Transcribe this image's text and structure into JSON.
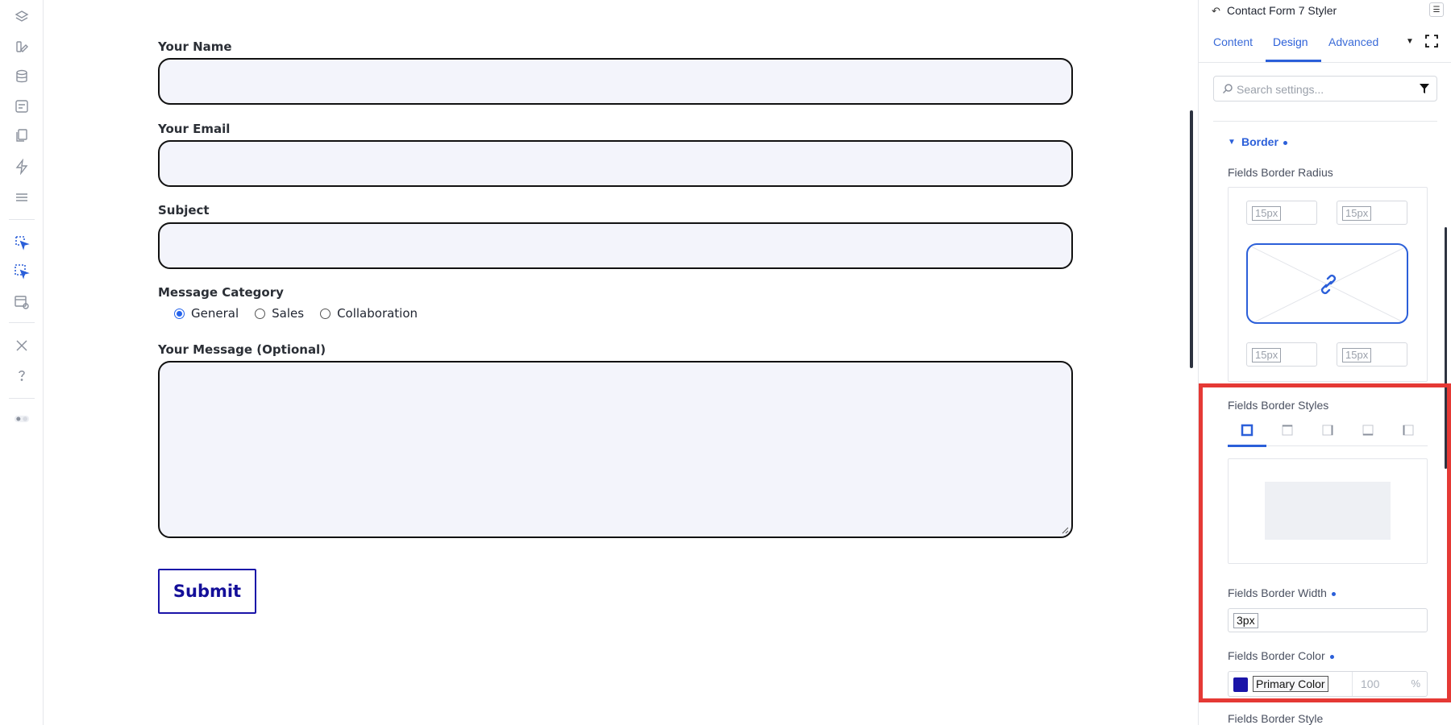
{
  "form": {
    "name_label": "Your Name",
    "email_label": "Your Email",
    "subject_label": "Subject",
    "category_label": "Message Category",
    "category_options": [
      "General",
      "Sales",
      "Collaboration"
    ],
    "category_selected": "General",
    "message_label": "Your Message (Optional)",
    "submit_label": "Submit"
  },
  "panel": {
    "title": "Contact Form 7 Styler",
    "tabs": [
      "Content",
      "Design",
      "Advanced"
    ],
    "active_tab": "Design",
    "search_placeholder": "Search settings...",
    "section_title": "Border",
    "radius_label": "Fields Border Radius",
    "radius_values": [
      "15px",
      "15px",
      "15px",
      "15px"
    ],
    "styles_label": "Fields Border Styles",
    "width_label": "Fields Border Width",
    "width_value": "3px",
    "color_label": "Fields Border Color",
    "color_name": "Primary Color",
    "color_hex": "#1a14a8",
    "opacity_placeholder": "100",
    "opacity_unit": "%",
    "style_label": "Fields Border Style"
  },
  "colors": {
    "accent": "#2b5fd9",
    "highlight": "#e53935",
    "field_bg": "#f3f4fb",
    "submit": "#140f99"
  }
}
